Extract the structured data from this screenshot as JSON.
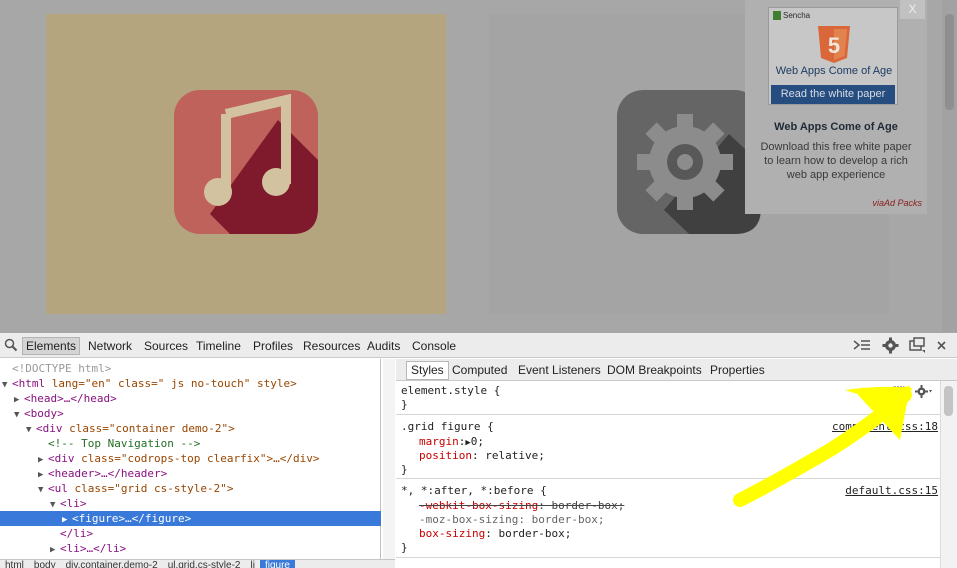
{
  "page": {
    "tiles": [
      {
        "name": "music-tile",
        "icon": "music-note-icon",
        "bg": "#b5a57f"
      },
      {
        "name": "settings-tile",
        "icon": "gear-icon",
        "bg": "#a4a4a4"
      }
    ]
  },
  "ad": {
    "brand": "Sencha",
    "banner_title": "Web Apps Come of Age",
    "button": "Read the white paper",
    "title": "Web Apps Come of Age",
    "description": "Download this free white paper to learn how to develop a rich web app experience",
    "via": "viaAd Packs",
    "close": "X",
    "shield_text": "5"
  },
  "devtools": {
    "tabs": [
      "Elements",
      "Network",
      "Sources",
      "Timeline",
      "Profiles",
      "Resources",
      "Audits",
      "Console"
    ],
    "active_tab": "Elements",
    "elements": [
      {
        "text": "<!DOCTYPE html>"
      },
      {
        "tag_open": "<html",
        "attrs": " lang=\"en\" class=\" js no-touch\" style>"
      },
      {
        "tag": "<head>…</head>"
      },
      {
        "tag": "<body>"
      },
      {
        "tag": "<div",
        "attrs": " class=\"container demo-2\">"
      },
      {
        "comment": "<!-- Top Navigation -->"
      },
      {
        "tag": "<div",
        "attrs": " class=\"codrops-top clearfix\">…</div>"
      },
      {
        "tag": "<header>…</header>"
      },
      {
        "tag": "<ul",
        "attrs": " class=\"grid cs-style-2\">"
      },
      {
        "tag": "<li>"
      },
      {
        "tag": "<figure>…</figure>"
      },
      {
        "tag": "</li>"
      },
      {
        "tag": "<li>…</li>"
      }
    ],
    "breadcrumb": [
      "html",
      "body",
      "div.container.demo-2",
      "ul.grid.cs-style-2",
      "li",
      "figure"
    ],
    "styles_tabs": [
      "Styles",
      "Computed",
      "Event Listeners",
      "DOM Breakpoints",
      "Properties"
    ],
    "active_styles_tab": "Styles",
    "rules": [
      {
        "selector": "element.style {",
        "source": "",
        "props": []
      },
      {
        "selector": ".grid figure {",
        "source": "component.css:18",
        "props": [
          {
            "name": "margin",
            "value": "0;",
            "struck": false,
            "expand": true
          },
          {
            "name": "position",
            "value": "relative;",
            "struck": false,
            "expand": false
          }
        ]
      },
      {
        "selector": "*, *:after, *:before {",
        "source": "default.css:15",
        "props": [
          {
            "name": "-webkit-box-sizing",
            "value": "border-box;",
            "struck": true,
            "expand": false
          },
          {
            "name": "-moz-box-sizing",
            "value": "border-box;",
            "struck": false,
            "dim": true,
            "expand": false
          },
          {
            "name": "box-sizing",
            "value": "border-box;",
            "struck": false,
            "expand": false
          }
        ]
      }
    ],
    "closing_brace": "}"
  },
  "colors": {
    "selection": "#3879d9",
    "annotation": "#ffff00"
  }
}
